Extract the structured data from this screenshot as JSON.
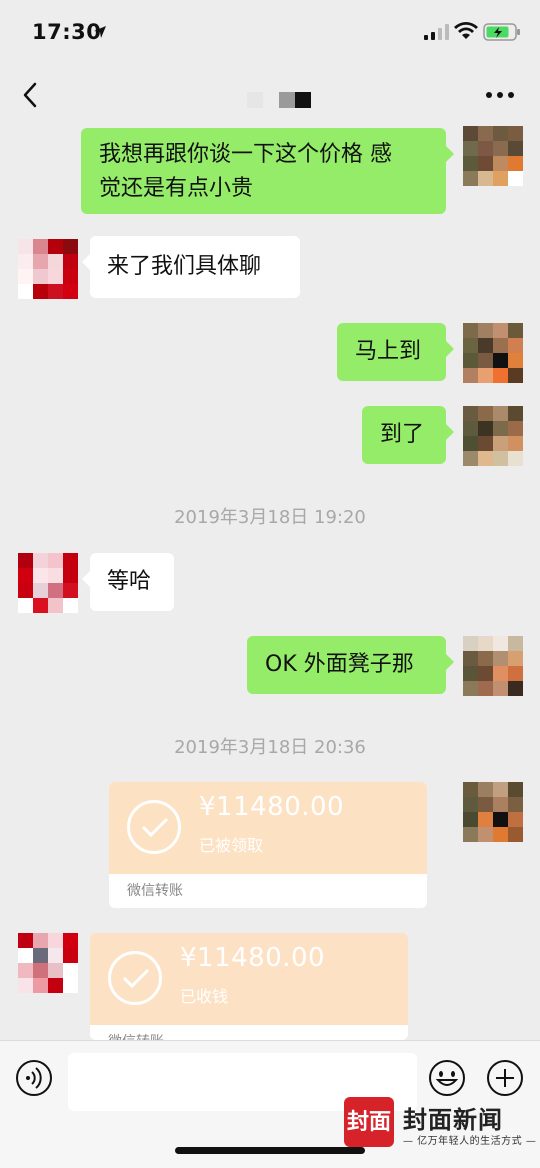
{
  "status_bar": {
    "time": "17:30"
  },
  "messages": [
    {
      "side": "out",
      "text_line1": "我想再跟你谈一下这个价格 感",
      "text_line2": "觉还是有点小贵"
    },
    {
      "side": "in",
      "text": "来了我们具体聊"
    },
    {
      "side": "out",
      "text": "马上到"
    },
    {
      "side": "out",
      "text": "到了"
    },
    {
      "side": "in",
      "text": "等哈"
    },
    {
      "side": "out",
      "text": "OK 外面凳子那"
    }
  ],
  "timestamps": [
    "2019年3月18日 19:20",
    "2019年3月18日 20:36"
  ],
  "transfers": [
    {
      "side": "out",
      "amount": "¥11480.00",
      "status": "已被领取",
      "footer": "微信转账"
    },
    {
      "side": "in",
      "amount": "¥11480.00",
      "status": "已收钱",
      "footer": "微信转账"
    }
  ],
  "icons": {
    "back": "back-chevron-icon",
    "more": "more-icon",
    "voice": "voice-icon",
    "emoji": "emoji-icon",
    "plus": "plus-icon"
  },
  "colors": {
    "outgoing_bubble": "#95ec69",
    "incoming_bubble": "#ffffff",
    "transfer_card": "#fce1c3",
    "background": "#ededed",
    "logo_red": "#d6232a"
  },
  "watermark": {
    "mark": "封面",
    "name": "封面新闻",
    "tagline": "— 亿万年轻人的生活方式 —"
  }
}
